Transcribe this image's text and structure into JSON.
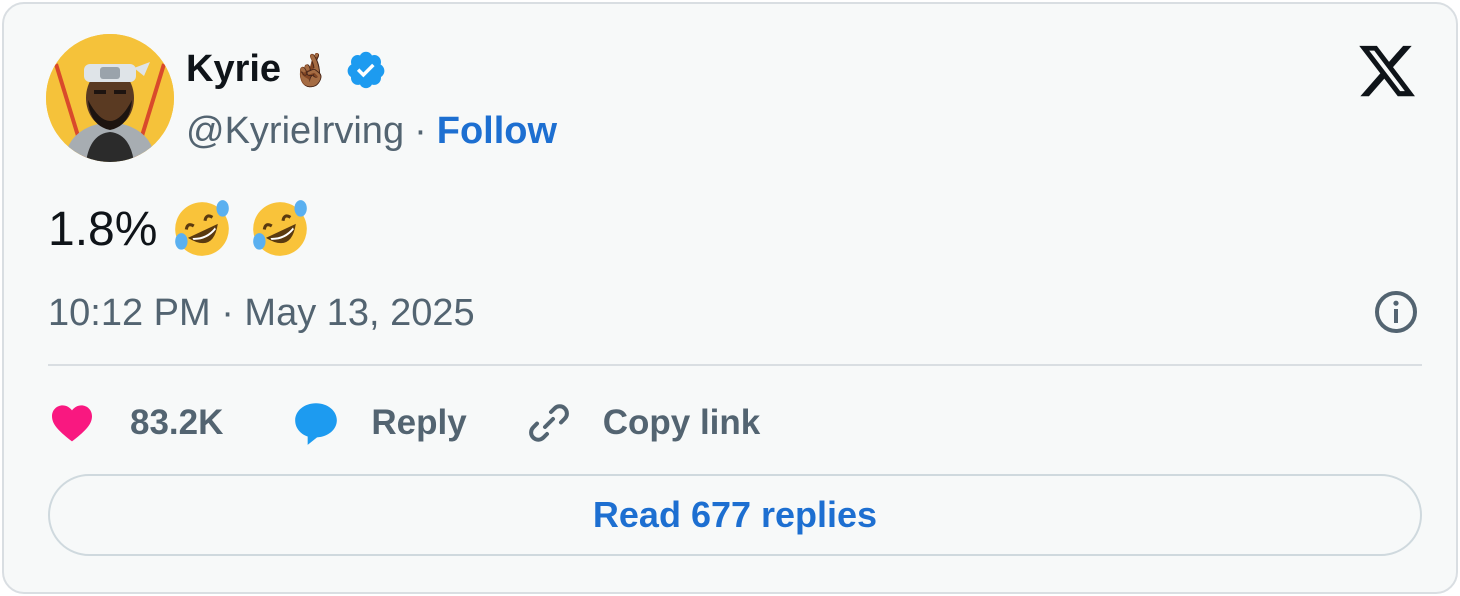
{
  "author": {
    "display_name": "Kyrie",
    "name_emoji": "🤞🏾",
    "handle": "@KyrieIrving",
    "separator": "·",
    "follow_label": "Follow",
    "verified": true
  },
  "tweet": {
    "text": "1.8%",
    "emojis": [
      "rolling-on-floor-laughing",
      "rolling-on-floor-laughing"
    ],
    "timestamp": "10:12 PM · May 13, 2025"
  },
  "actions": {
    "like_count": "83.2K",
    "reply_label": "Reply",
    "copy_link_label": "Copy link"
  },
  "footer": {
    "read_replies_label": "Read 677 replies"
  },
  "icons": {
    "like": "heart-icon",
    "reply": "speech-bubble-icon",
    "copy": "link-icon",
    "info": "info-icon",
    "logo": "x-logo-icon",
    "verified": "verified-badge-icon"
  },
  "colors": {
    "card_background": "#f7f9f9",
    "text_primary": "#0f1419",
    "text_secondary": "#536471",
    "link_blue": "#1d6fd1",
    "heart_pink": "#f91880",
    "reply_blue": "#1d9bf0",
    "verified_blue": "#1d9bf0"
  }
}
